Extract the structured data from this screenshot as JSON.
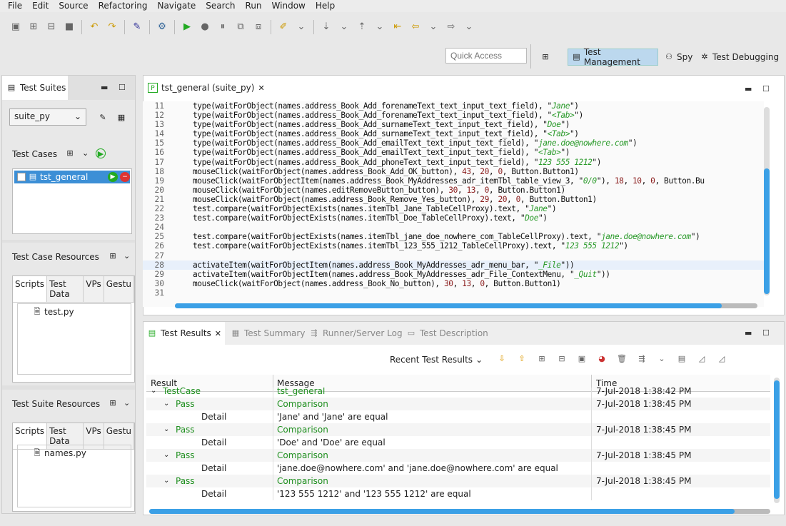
{
  "menu": [
    "File",
    "Edit",
    "Source",
    "Refactoring",
    "Navigate",
    "Search",
    "Run",
    "Window",
    "Help"
  ],
  "quick_access": {
    "placeholder": "Quick Access"
  },
  "perspectives": [
    {
      "label": "Test Management",
      "active": true
    },
    {
      "label": "Spy"
    },
    {
      "label": "Test Debugging"
    }
  ],
  "left": {
    "suites_tab": "Test Suites",
    "suite_select": "suite_py",
    "test_cases_label": "Test Cases",
    "test_case": "tst_general",
    "tc_resources_label": "Test Case Resources",
    "tc_tabs": [
      "Scripts",
      "Test Data",
      "VPs",
      "Gestu"
    ],
    "tc_file": "test.py",
    "ts_resources_label": "Test Suite Resources",
    "ts_tabs": [
      "Scripts",
      "Test Data",
      "VPs",
      "Gestu"
    ],
    "ts_file": "names.py"
  },
  "editor": {
    "tab": "tst_general (suite_py)",
    "highlight_line": 28,
    "lines": [
      [
        11,
        "type(waitForObject(names.address_Book_Add_forenameText_text_input_text_field), \"Jane\")"
      ],
      [
        12,
        "type(waitForObject(names.address_Book_Add_forenameText_text_input_text_field), \"<Tab>\")"
      ],
      [
        13,
        "type(waitForObject(names.address_Book_Add_surnameText_text_input_text_field), \"Doe\")"
      ],
      [
        14,
        "type(waitForObject(names.address_Book_Add_surnameText_text_input_text_field), \"<Tab>\")"
      ],
      [
        15,
        "type(waitForObject(names.address_Book_Add_emailText_text_input_text_field), \"jane.doe@nowhere.com\")"
      ],
      [
        16,
        "type(waitForObject(names.address_Book_Add_emailText_text_input_text_field), \"<Tab>\")"
      ],
      [
        17,
        "type(waitForObject(names.address_Book_Add_phoneText_text_input_text_field), \"123 555 1212\")"
      ],
      [
        18,
        "mouseClick(waitForObject(names.address_Book_Add_OK_button), 43, 20, 0, Button.Button1)"
      ],
      [
        19,
        "mouseClick(waitForObjectItem(names.address_Book_MyAddresses_adr_itemTbl_table_view_3, \"0/0\"), 18, 10, 0, Button.Bu"
      ],
      [
        20,
        "mouseClick(waitForObject(names.editRemoveButton_button), 30, 13, 0, Button.Button1)"
      ],
      [
        21,
        "mouseClick(waitForObject(names.address_Book_Remove_Yes_button), 29, 20, 0, Button.Button1)"
      ],
      [
        22,
        "test.compare(waitForObjectExists(names.itemTbl_Jane_TableCellProxy).text, \"Jane\")"
      ],
      [
        23,
        "test.compare(waitForObjectExists(names.itemTbl_Doe_TableCellProxy).text, \"Doe\")"
      ],
      [
        24,
        ""
      ],
      [
        25,
        "test.compare(waitForObjectExists(names.itemTbl_jane_doe_nowhere_com_TableCellProxy).text, \"jane.doe@nowhere.com\")"
      ],
      [
        26,
        "test.compare(waitForObjectExists(names.itemTbl_123_555_1212_TableCellProxy).text, \"123 555 1212\")"
      ],
      [
        27,
        ""
      ],
      [
        28,
        "activateItem(waitForObjectItem(names.address_Book_MyAddresses_adr_menu_bar, \"_File\"))"
      ],
      [
        29,
        "activateItem(waitForObjectItem(names.address_Book_MyAddresses_adr_File_ContextMenu, \"_Quit\"))"
      ],
      [
        30,
        "mouseClick(waitForObject(names.address_Book_No_button), 30, 13, 0, Button.Button1)"
      ],
      [
        31,
        ""
      ]
    ]
  },
  "results": {
    "tabs": [
      "Test Results",
      "Test Summary",
      "Runner/Server Log",
      "Test Description"
    ],
    "recent": "Recent Test Results",
    "columns": [
      "Result",
      "Message",
      "Time"
    ],
    "rows": [
      {
        "level": 0,
        "result": "TestCase",
        "message": "tst_general",
        "time": "7-Jul-2018 1:38:42 PM",
        "green": true
      },
      {
        "level": 1,
        "result": "Pass",
        "message": "Comparison",
        "time": "7-Jul-2018 1:38:45 PM",
        "green": true
      },
      {
        "level": 2,
        "result": "Detail",
        "message": "'Jane' and 'Jane' are equal",
        "time": ""
      },
      {
        "level": 1,
        "result": "Pass",
        "message": "Comparison",
        "time": "7-Jul-2018 1:38:45 PM",
        "green": true
      },
      {
        "level": 2,
        "result": "Detail",
        "message": "'Doe' and 'Doe' are equal",
        "time": ""
      },
      {
        "level": 1,
        "result": "Pass",
        "message": "Comparison",
        "time": "7-Jul-2018 1:38:45 PM",
        "green": true
      },
      {
        "level": 2,
        "result": "Detail",
        "message": "'jane.doe@nowhere.com' and 'jane.doe@nowhere.com' are equal",
        "time": ""
      },
      {
        "level": 1,
        "result": "Pass",
        "message": "Comparison",
        "time": "7-Jul-2018 1:38:45 PM",
        "green": true
      },
      {
        "level": 2,
        "result": "Detail",
        "message": "'123 555 1212' and '123 555 1212' are equal",
        "time": ""
      }
    ]
  }
}
